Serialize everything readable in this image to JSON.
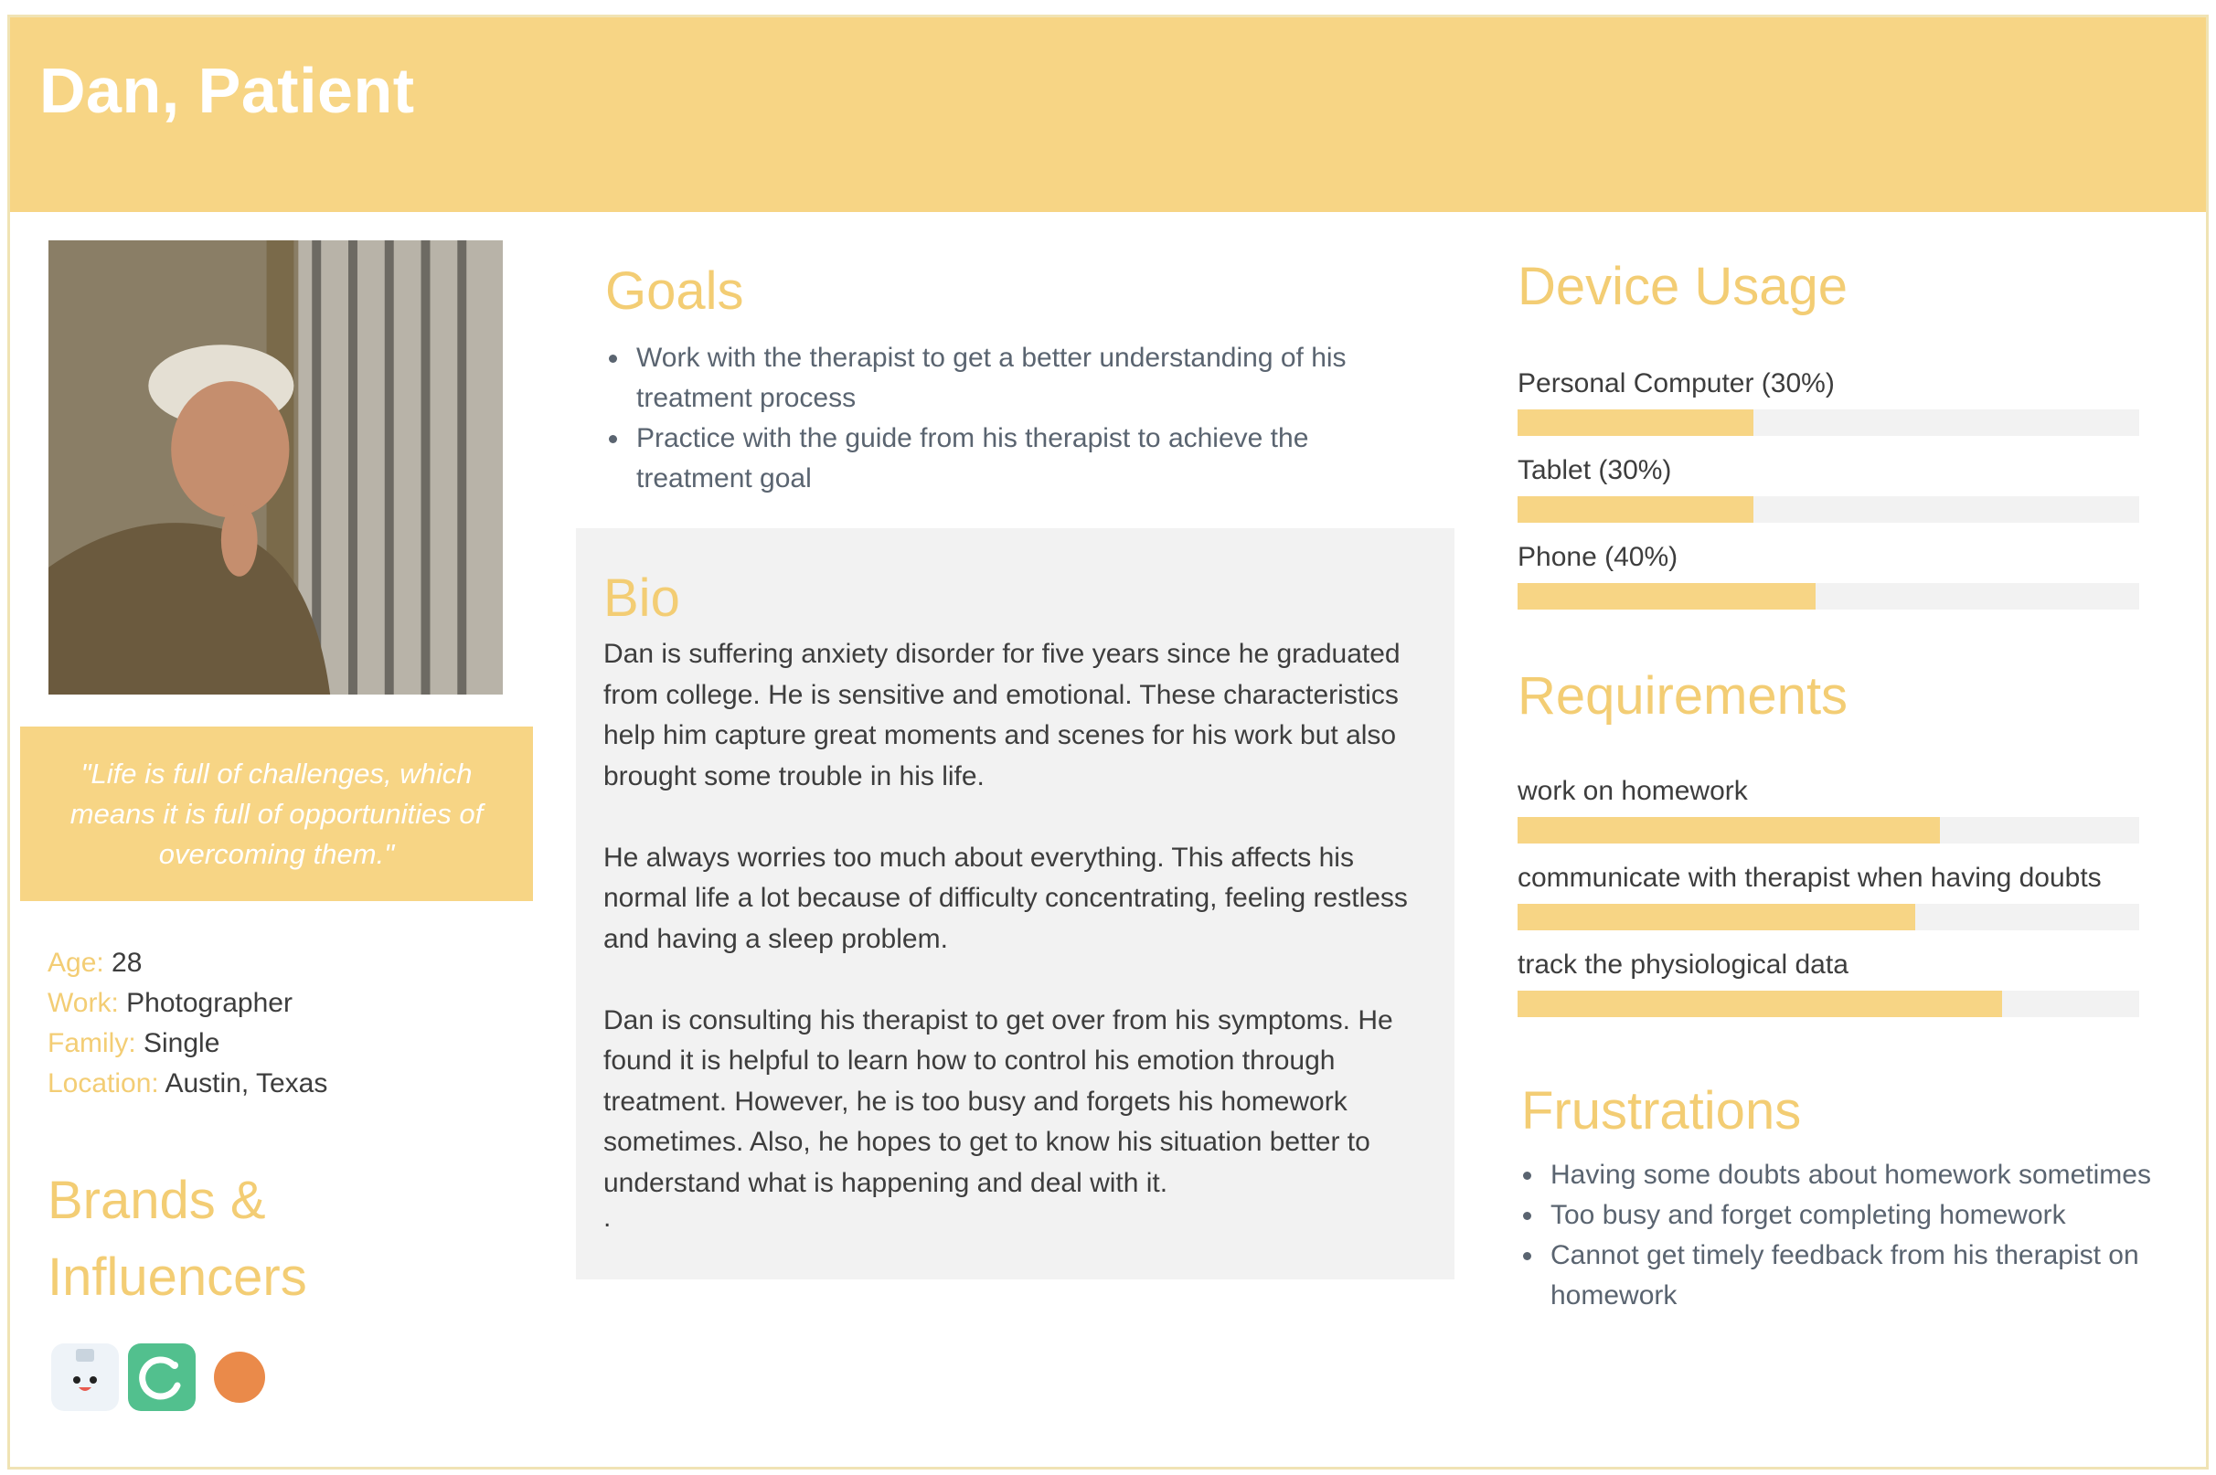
{
  "header": {
    "title": "Dan, Patient"
  },
  "profile": {
    "photo_icon": "person-photo",
    "quote": "\"Life is full of challenges, which means it is full of opportunities of overcoming them.\"",
    "facts": [
      {
        "key": "Age:",
        "value": " 28"
      },
      {
        "key": "Work:",
        "value": " Photographer"
      },
      {
        "key": "Family:",
        "value": " Single"
      },
      {
        "key": "Location:",
        "value": " Austin, Texas"
      }
    ]
  },
  "brands": {
    "title": "Brands & Influencers",
    "icons": [
      "robot-app-icon",
      "green-c-app-icon",
      "orange-circle-icon"
    ]
  },
  "goals": {
    "title": "Goals",
    "items": [
      "Work with the therapist to get a better understanding of his treatment process",
      "Practice with the guide from his therapist to achieve the treatment goal"
    ]
  },
  "bio": {
    "title": "Bio",
    "paragraphs": [
      "Dan is suffering anxiety disorder for five years since he graduated from college. He is sensitive and emotional. These characteristics help him capture great moments and scenes for his work but also brought some trouble in his life.",
      "He always worries too much about everything. This affects his normal life a lot because of difficulty concentrating, feeling restless and having a sleep problem.",
      "Dan is consulting his therapist to get over from his symptoms. He found it is helpful to learn how to control his emotion through treatment. However, he is too busy and forgets his homework sometimes. Also, he hopes to get to know his situation better to understand what is happening and deal with it."
    ],
    "trailing": "."
  },
  "device_usage": {
    "title": "Device Usage",
    "items": [
      {
        "label": "Personal Computer (30%)",
        "value": 0.38
      },
      {
        "label": "Tablet (30%)",
        "value": 0.38
      },
      {
        "label": "Phone (40%)",
        "value": 0.48
      }
    ]
  },
  "requirements": {
    "title": "Requirements",
    "items": [
      {
        "label": "work on homework",
        "value": 0.68
      },
      {
        "label": "communicate with therapist when having doubts",
        "value": 0.64
      },
      {
        "label": "track the physiological data",
        "value": 0.78
      }
    ]
  },
  "frustrations": {
    "title": "Frustrations",
    "items": [
      "Having some doubts about homework sometimes",
      "Too busy and forget completing homework",
      "Cannot get timely feedback from his therapist on homework"
    ]
  },
  "colors": {
    "accent": "#f7d585",
    "accent_text": "#f3cd74",
    "panel": "#f2f2f2",
    "body_text": "#3d3d3d"
  }
}
